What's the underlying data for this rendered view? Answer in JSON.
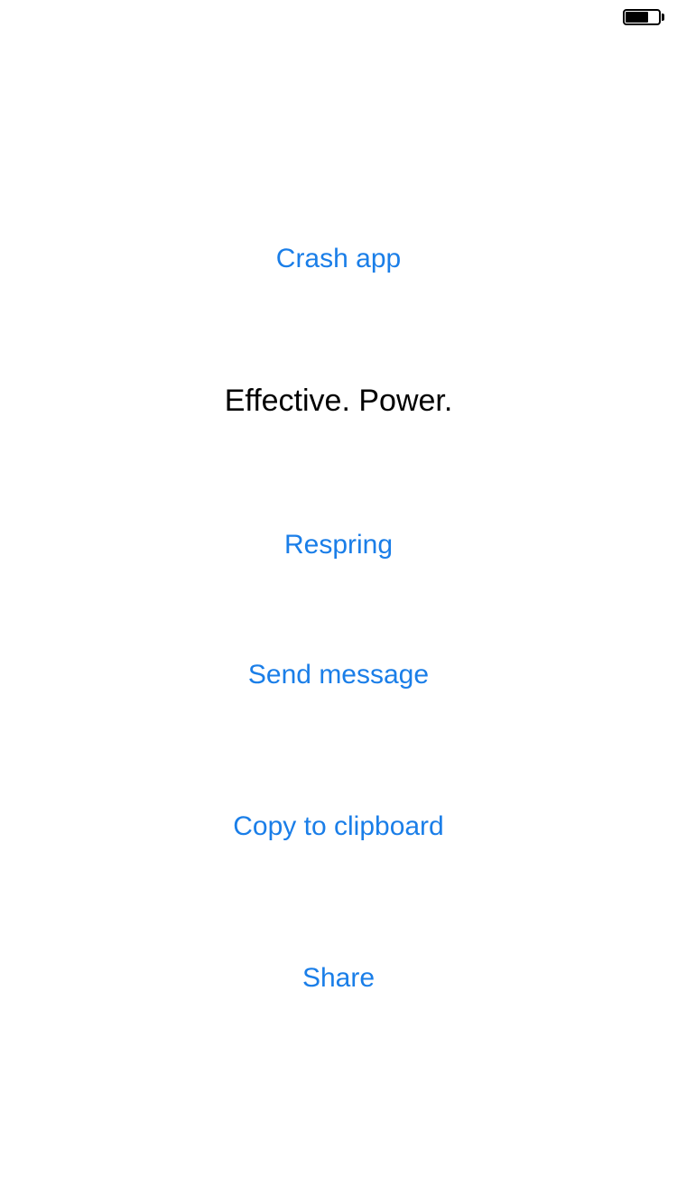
{
  "status_bar": {
    "battery_level": 0.7,
    "battery_icon": "battery-icon"
  },
  "actions": {
    "crash_label": "Crash app",
    "respring_label": "Respring",
    "send_message_label": "Send message",
    "copy_label": "Copy to clipboard",
    "share_label": "Share"
  },
  "headline": "Effective.  Power.",
  "colors": {
    "accent": "#1a7ee8",
    "text": "#000000",
    "background": "#ffffff"
  }
}
